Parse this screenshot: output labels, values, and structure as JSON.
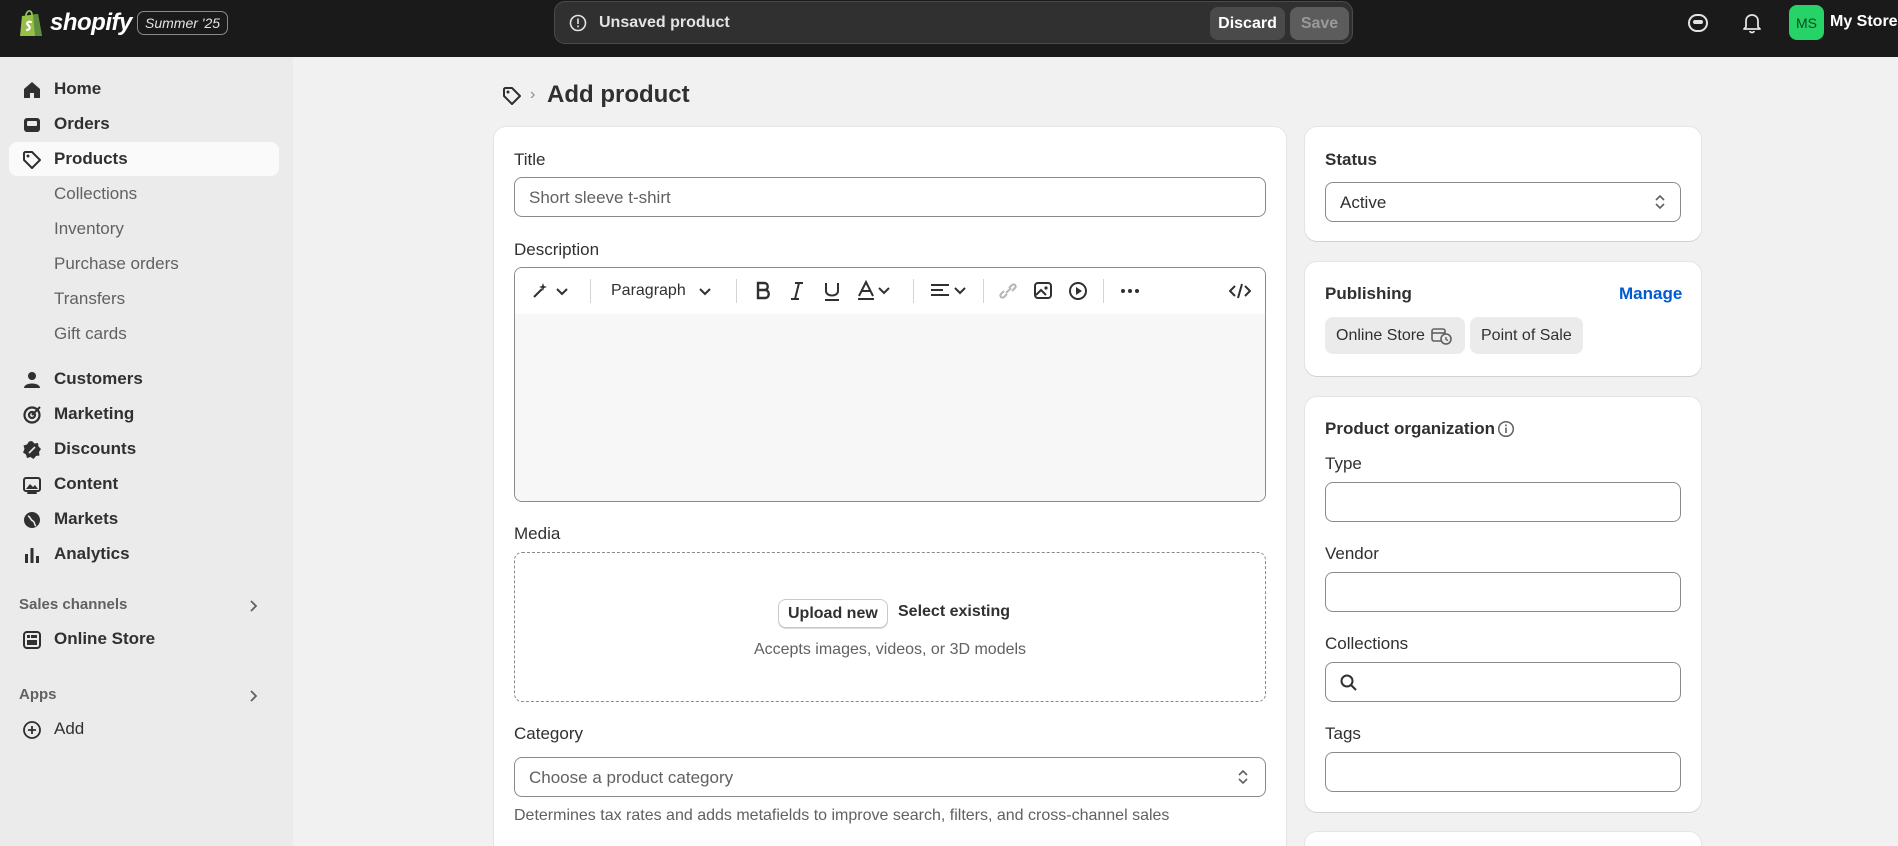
{
  "topbar": {
    "brand": "shopify",
    "edition": "Summer '25",
    "unsaved_message": "Unsaved product",
    "discard_label": "Discard",
    "save_label": "Save",
    "avatar_initials": "MS",
    "store_name": "My Store",
    "brand_color": "#95bf47"
  },
  "sidebar": {
    "items": [
      {
        "label": "Home",
        "icon": "home-icon"
      },
      {
        "label": "Orders",
        "icon": "inbox-icon"
      },
      {
        "label": "Products",
        "icon": "tag-icon",
        "active": true
      },
      {
        "label": "Collections"
      },
      {
        "label": "Inventory"
      },
      {
        "label": "Purchase orders"
      },
      {
        "label": "Transfers"
      },
      {
        "label": "Gift cards"
      },
      {
        "label": "Customers",
        "icon": "person-icon"
      },
      {
        "label": "Marketing",
        "icon": "target-icon"
      },
      {
        "label": "Discounts",
        "icon": "discount-icon"
      },
      {
        "label": "Content",
        "icon": "image-icon"
      },
      {
        "label": "Markets",
        "icon": "globe-icon"
      },
      {
        "label": "Analytics",
        "icon": "chart-icon"
      }
    ],
    "sales_channels_header": "Sales channels",
    "online_store": "Online Store",
    "apps_header": "Apps",
    "add_label": "Add"
  },
  "page": {
    "title": "Add product"
  },
  "product_form": {
    "title_label": "Title",
    "title_placeholder": "Short sleeve t-shirt",
    "description_label": "Description",
    "paragraph_label": "Paragraph",
    "media_label": "Media",
    "upload_new": "Upload new",
    "select_existing": "Select existing",
    "accepts_text": "Accepts images, videos, or 3D models",
    "category_label": "Category",
    "category_placeholder": "Choose a product category",
    "category_help": "Determines tax rates and adds metafields to improve search, filters, and cross-channel sales"
  },
  "status_card": {
    "label": "Status",
    "value": "Active"
  },
  "publishing": {
    "label": "Publishing",
    "manage": "Manage",
    "channels": [
      "Online Store",
      "Point of Sale"
    ]
  },
  "organization": {
    "label": "Product organization",
    "type_label": "Type",
    "vendor_label": "Vendor",
    "collections_label": "Collections",
    "tags_label": "Tags"
  }
}
